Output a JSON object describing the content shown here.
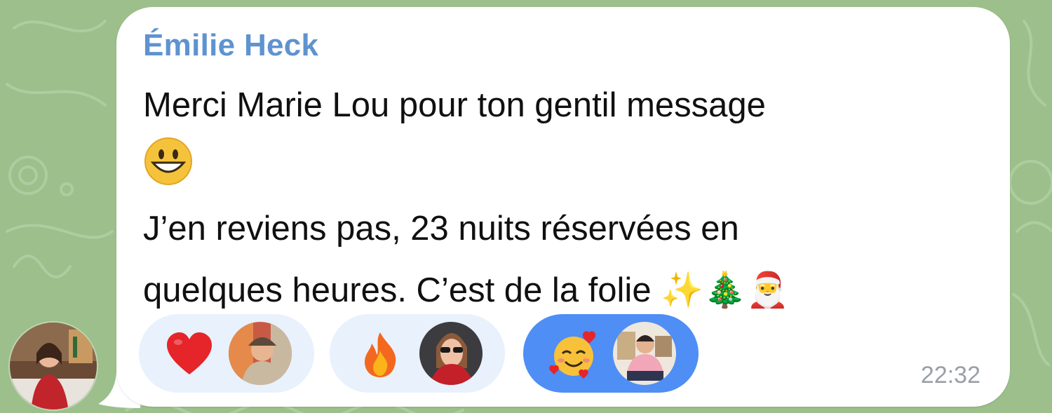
{
  "message": {
    "sender": "Émilie Heck",
    "lines": [
      "Merci Marie Lou pour ton gentil message",
      "😃",
      "J’en reviens pas, 23 nuits réservées en",
      "quelques heures. C’est de la folie ✨🎄🎅"
    ],
    "time": "22:32"
  },
  "reactions": [
    {
      "emoji": "❤️",
      "icon": "red-heart-icon",
      "selected": false
    },
    {
      "emoji": "🔥",
      "icon": "fire-icon",
      "selected": false
    },
    {
      "emoji": "🥰",
      "icon": "smiling-face-with-hearts-icon",
      "selected": true
    }
  ],
  "colors": {
    "wallpaper": "#9cbf8c",
    "sender_name": "#5f93cf",
    "reaction_chip": "#e8f1fc",
    "reaction_chip_selected": "#4e8ef5",
    "timestamp": "#9a9fa5"
  }
}
